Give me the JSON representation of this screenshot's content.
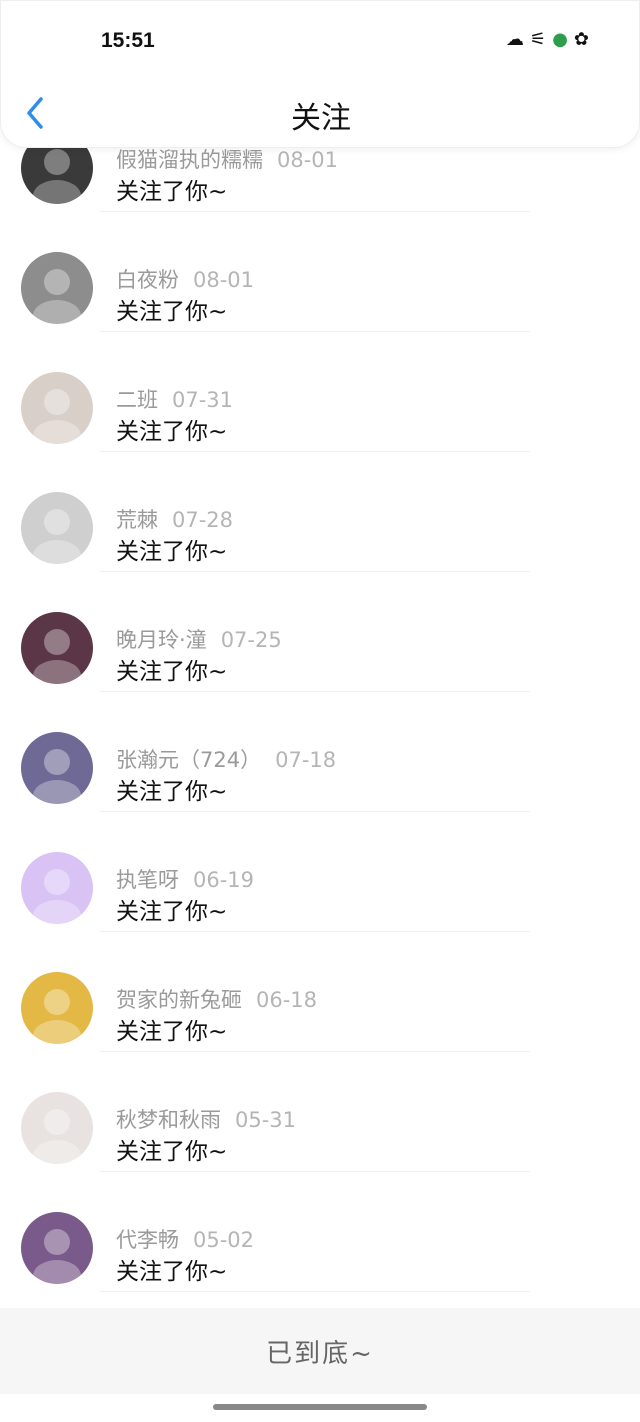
{
  "status": {
    "time": "15:51",
    "icons": [
      "cloud-status-icon",
      "signal-icon",
      "battery-icon",
      "star-icon"
    ]
  },
  "header": {
    "title": "关注"
  },
  "items": [
    {
      "name": "假猫溜执的糯糯",
      "date": "08-01",
      "action": "关注了你~",
      "avatar_color": "#3a3a3a"
    },
    {
      "name": "白夜粉",
      "date": "08-01",
      "action": "关注了你~",
      "avatar_color": "#8d8d8d"
    },
    {
      "name": "二班",
      "date": "07-31",
      "action": "关注了你~",
      "avatar_color": "#d8cfc8"
    },
    {
      "name": "荒棘",
      "date": "07-28",
      "action": "关注了你~",
      "avatar_color": "#cfcfcf"
    },
    {
      "name": "晚月玲·潼",
      "date": "07-25",
      "action": "关注了你~",
      "avatar_color": "#5a3646"
    },
    {
      "name": "张瀚元（724）",
      "date": "07-18",
      "action": "关注了你~",
      "avatar_color": "#6f6a95"
    },
    {
      "name": "执笔呀",
      "date": "06-19",
      "action": "关注了你~",
      "avatar_color": "#d9c3f5"
    },
    {
      "name": "贺家的新兔砸",
      "date": "06-18",
      "action": "关注了你~",
      "avatar_color": "#e3b844"
    },
    {
      "name": "秋梦和秋雨",
      "date": "05-31",
      "action": "关注了你~",
      "avatar_color": "#e8e2e0"
    },
    {
      "name": "代李畅",
      "date": "05-02",
      "action": "关注了你~",
      "avatar_color": "#7a5a8a"
    }
  ],
  "footer": {
    "text": "已到底~"
  }
}
